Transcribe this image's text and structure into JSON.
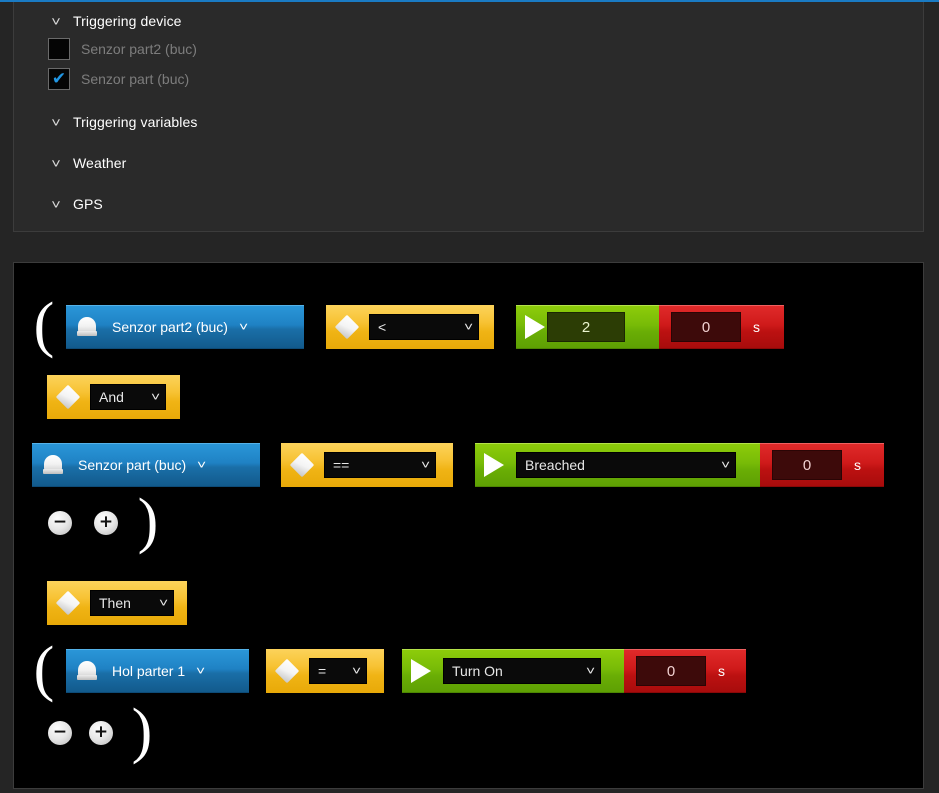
{
  "colors": {
    "accent_blue": "#1a7bc4",
    "panel_bg": "#2a2a2a",
    "rule_bg": "#000000",
    "device_blue": "#1f82c4",
    "operator_yellow": "#f7c233",
    "action_green": "#78bb07",
    "timer_red": "#cf1a1a",
    "checkbox_tick": "#2196e3"
  },
  "filters": {
    "groups": [
      {
        "label": "Triggering device",
        "chevron": "chevron-down-icon",
        "expanded": true
      },
      {
        "label": "Triggering variables",
        "chevron": "chevron-down-icon",
        "expanded": false
      },
      {
        "label": "Weather",
        "chevron": "chevron-down-icon",
        "expanded": false
      },
      {
        "label": "GPS",
        "chevron": "chevron-down-icon",
        "expanded": false
      }
    ],
    "devices": [
      {
        "label": "Senzor part2 (buc)",
        "checked": false,
        "check_glyph": ""
      },
      {
        "label": "Senzor part (buc)",
        "checked": true,
        "check_glyph": "✔"
      }
    ]
  },
  "rule": {
    "open_paren": "(",
    "close_paren": ")",
    "rows": [
      {
        "device": {
          "icon": "device-dome-icon",
          "label": "Senzor part2 (buc)",
          "caret": "ˇ"
        },
        "operator": {
          "icon": "diamond-icon",
          "value": "<",
          "caret": "ˇ"
        },
        "action": {
          "icon": "play-icon",
          "value": "2"
        },
        "timer": {
          "value": "0",
          "unit": "s"
        }
      },
      {
        "device": {
          "icon": "device-dome-icon",
          "label": "Senzor part (buc)",
          "caret": "ˇ"
        },
        "operator": {
          "icon": "diamond-icon",
          "value": "==",
          "caret": "ˇ"
        },
        "action": {
          "icon": "play-icon",
          "value": "Breached",
          "caret": "ˇ"
        },
        "timer": {
          "value": "0",
          "unit": "s"
        }
      }
    ],
    "action_row": {
      "device": {
        "icon": "device-dome-icon",
        "label": "Hol parter 1",
        "caret": "ˇ"
      },
      "operator": {
        "icon": "diamond-icon",
        "value": "=",
        "caret": "ˇ"
      },
      "action": {
        "icon": "play-icon",
        "value": "Turn On",
        "caret": "ˇ"
      },
      "timer": {
        "value": "0",
        "unit": "s"
      }
    },
    "connectors": {
      "and": {
        "icon": "diamond-icon",
        "value": "And",
        "caret": "ˇ"
      },
      "then": {
        "icon": "diamond-icon",
        "value": "Then",
        "caret": "ˇ"
      }
    },
    "buttons": {
      "minus": "−",
      "plus": "+"
    }
  }
}
